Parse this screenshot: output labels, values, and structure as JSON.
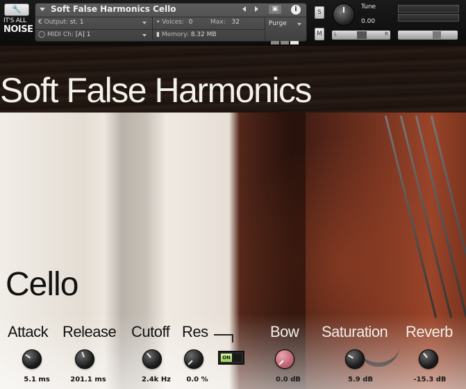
{
  "header": {
    "settings_icon": "wrench-icon",
    "logo_top": "IT'S ALL",
    "logo_bottom": "NOISE",
    "instrument_name": "Soft False Harmonics Cello",
    "output_label": "Output:",
    "output_value": "st. 1",
    "voices_label": "Voices:",
    "voices_value": "0",
    "max_label": "Max:",
    "max_value": "32",
    "purge_label": "Purge",
    "midi_label": "MIDI Ch:",
    "midi_value": "[A]  1",
    "memory_label": "Memory:",
    "memory_value": "8.32 MB",
    "solo_label": "S",
    "mute_label": "M",
    "tune_label": "Tune",
    "tune_value": "0.00",
    "pan_left": "L",
    "pan_right": "R",
    "info_icon": "i"
  },
  "title": "Soft False Harmonics",
  "instrument": "Cello",
  "controls": [
    {
      "label": "Attack",
      "value": "5.1 ms"
    },
    {
      "label": "Release",
      "value": "201.1 ms"
    },
    {
      "label": "Cutoff",
      "value": "2.4k Hz"
    },
    {
      "label": "Res",
      "value": "0.0 %"
    },
    {
      "label": "Bow",
      "value": "0.0 dB"
    },
    {
      "label": "Saturation",
      "value": "5.9 dB"
    },
    {
      "label": "Reverb",
      "value": "-15.3 dB"
    }
  ],
  "toggle": {
    "label": "ON",
    "state": "on"
  },
  "colors": {
    "accent_pink": "#c36f7c",
    "toggle_on": "#b6e77a"
  }
}
